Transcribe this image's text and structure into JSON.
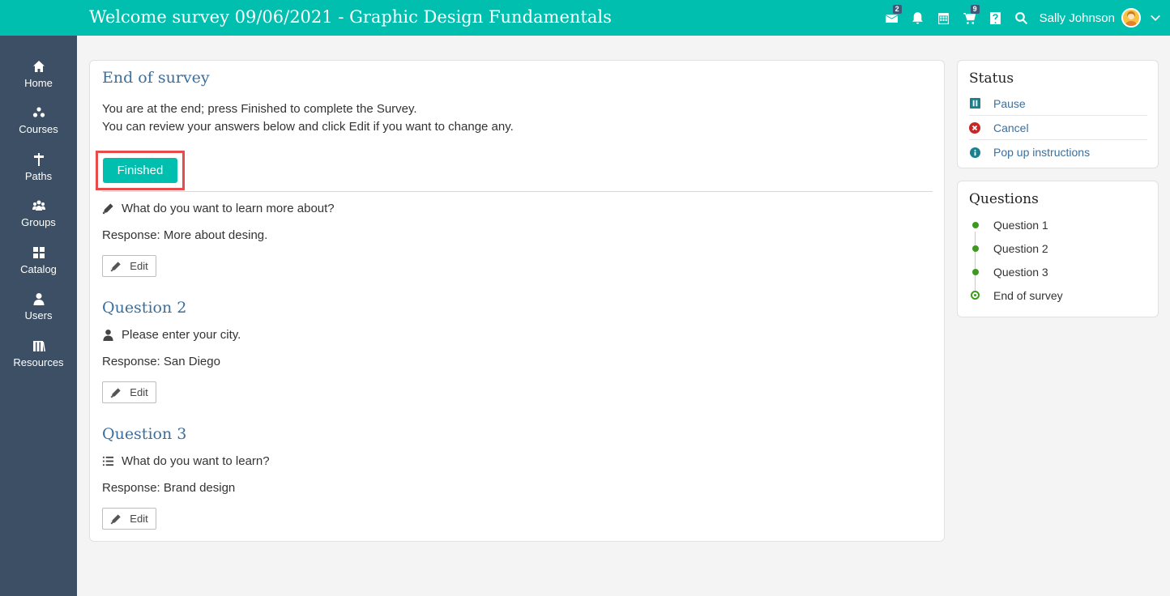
{
  "header": {
    "title": "Welcome survey 09/06/2021 - Graphic Design Fundamentals",
    "icons": [
      {
        "name": "messages-icon",
        "badge": "2"
      },
      {
        "name": "bell-icon",
        "badge": ""
      },
      {
        "name": "calendar-icon",
        "badge": ""
      },
      {
        "name": "cart-icon",
        "badge": "9"
      },
      {
        "name": "help-icon",
        "badge": ""
      },
      {
        "name": "search-icon",
        "badge": ""
      }
    ],
    "user_name": "Sally Johnson"
  },
  "sidebar": {
    "items": [
      {
        "label": "Home",
        "icon": "home-icon"
      },
      {
        "label": "Courses",
        "icon": "courses-icon"
      },
      {
        "label": "Paths",
        "icon": "paths-icon"
      },
      {
        "label": "Groups",
        "icon": "groups-icon"
      },
      {
        "label": "Catalog",
        "icon": "catalog-icon"
      },
      {
        "label": "Users",
        "icon": "user-icon"
      },
      {
        "label": "Resources",
        "icon": "resources-icon"
      }
    ]
  },
  "main": {
    "title": "End of survey",
    "line1": "You are at the end; press Finished to complete the Survey.",
    "line2": "You can review your answers below and click Edit if you want to change any.",
    "finished_label": "Finished",
    "questions": [
      {
        "heading": "",
        "prompt": "What do you want to learn more about?",
        "icon": "pencil-icon",
        "response_label": "Response",
        "response_value": ": More about desing.",
        "edit_label": "Edit"
      },
      {
        "heading": "Question 2",
        "prompt": "Please enter your city.",
        "icon": "person-icon",
        "response_label": "Response",
        "response_value": ": San Diego",
        "edit_label": "Edit"
      },
      {
        "heading": "Question 3",
        "prompt": "What do you want to learn?",
        "icon": "list-icon",
        "response_label": "Response",
        "response_value": ": Brand design",
        "edit_label": "Edit"
      }
    ]
  },
  "status": {
    "title": "Status",
    "items": [
      {
        "label": "Pause",
        "icon": "pause-icon",
        "color": "#1a7f8f"
      },
      {
        "label": "Cancel",
        "icon": "cancel-icon",
        "color": "#c62828"
      },
      {
        "label": "Pop up instructions",
        "icon": "info-icon",
        "color": "#1a7f8f"
      }
    ]
  },
  "questions_nav": {
    "title": "Questions",
    "items": [
      "Question 1",
      "Question 2",
      "Question 3",
      "End of survey"
    ],
    "current": "End of survey"
  },
  "colors": {
    "accent": "#00bfae",
    "sidebar": "#3c4f64",
    "link": "#3b6f9c",
    "highlight": "#e84b4b",
    "progress": "#3d9a1e"
  }
}
